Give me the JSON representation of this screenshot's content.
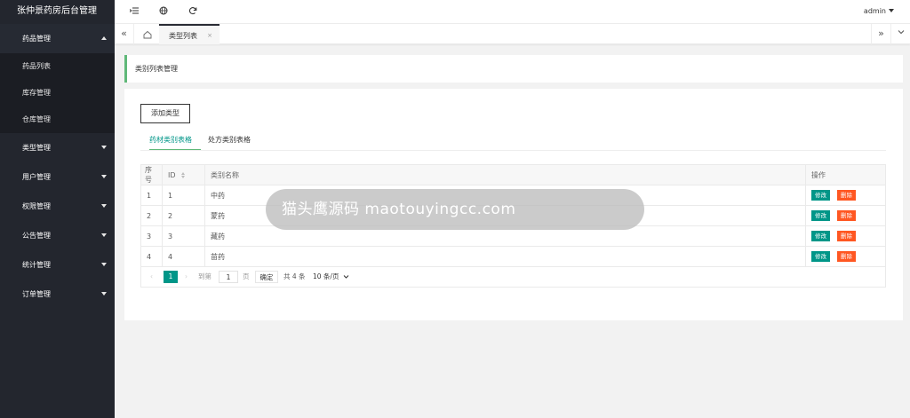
{
  "app": {
    "title": "张仲景药房后台管理"
  },
  "sidebar": {
    "items": [
      {
        "label": "药品管理",
        "open": true,
        "children": [
          "药品列表",
          "库存管理",
          "仓库管理"
        ]
      },
      {
        "label": "类型管理"
      },
      {
        "label": "用户管理"
      },
      {
        "label": "权限管理"
      },
      {
        "label": "公告管理"
      },
      {
        "label": "统计管理"
      },
      {
        "label": "订单管理"
      }
    ]
  },
  "topbar": {
    "user": "admin"
  },
  "tabsbar": {
    "active_tab": "类型列表",
    "close": "×"
  },
  "page": {
    "title": "类别列表管理"
  },
  "toolbar": {
    "add_label": "添加类型"
  },
  "tabs": [
    "药材类别表格",
    "处方类别表格"
  ],
  "table": {
    "headers": {
      "index": "序号",
      "id": "ID",
      "name": "类别名称",
      "ops": "操作"
    },
    "rows": [
      {
        "index": "1",
        "id": "1",
        "name": "中药"
      },
      {
        "index": "2",
        "id": "2",
        "name": "蒙药"
      },
      {
        "index": "3",
        "id": "3",
        "name": "藏药"
      },
      {
        "index": "4",
        "id": "4",
        "name": "苗药"
      }
    ],
    "edit_label": "修改",
    "delete_label": "删除"
  },
  "pager": {
    "current": "1",
    "goto_label": "到第",
    "page_value": "1",
    "page_unit": "页",
    "confirm": "确定",
    "total": "共 4 条",
    "page_size": "10 条/页"
  },
  "overlay": {
    "text": "猫头鹰源码 maotouyingcc.com"
  },
  "colors": {
    "sidebar": "#23262e",
    "accent": "#009688",
    "danger": "#ff5722",
    "tab_active": "#5fb878"
  }
}
